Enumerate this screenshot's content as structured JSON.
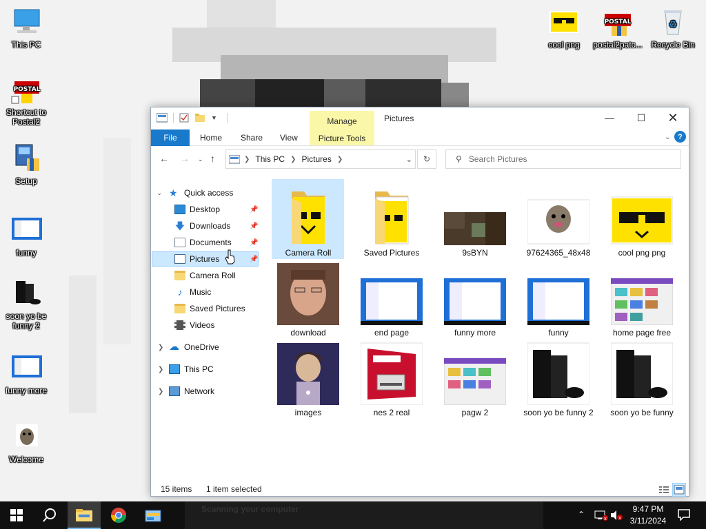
{
  "desktop": {
    "icons_left": [
      {
        "label": "This PC"
      },
      {
        "label": "Shortcut to Postal2"
      },
      {
        "label": "Setup"
      },
      {
        "label": "funny"
      },
      {
        "label": "soon yo be funny 2"
      },
      {
        "label": "funny more"
      },
      {
        "label": "Welcome"
      }
    ],
    "icons_top": [
      {
        "label": "cool png"
      },
      {
        "label": "postal2patc..."
      },
      {
        "label": "Recycle Bin"
      }
    ]
  },
  "window": {
    "title": "Pictures",
    "manage_tab": "Manage",
    "picture_tools_tab": "Picture Tools",
    "ribbon_tabs": [
      "File",
      "Home",
      "Share",
      "View"
    ],
    "address_parts": [
      "This PC",
      "Pictures"
    ],
    "search_placeholder": "Search Pictures",
    "nav": {
      "quick_access": "Quick access",
      "items": [
        "Desktop",
        "Downloads",
        "Documents",
        "Pictures",
        "Camera Roll",
        "Music",
        "Saved Pictures",
        "Videos"
      ],
      "roots": [
        "OneDrive",
        "This PC",
        "Network"
      ]
    },
    "files": [
      "Camera Roll",
      "Saved Pictures",
      "9sBYN",
      "97624365_48x48",
      "cool png png",
      "download",
      "end page",
      "funny more",
      "funny",
      "home page free",
      "images",
      "nes 2 real",
      "pagw 2",
      "soon yo be funny 2",
      "soon yo be funny"
    ],
    "status": {
      "count": "15 items",
      "selected": "1 item selected"
    }
  },
  "taskbar": {
    "time": "9:47 PM",
    "date": "3/11/2024",
    "scan_text": "Scanning your computer"
  },
  "colors": {
    "accent": "#1979ca",
    "selection": "#cce8ff",
    "manage": "#fbf7a8"
  }
}
